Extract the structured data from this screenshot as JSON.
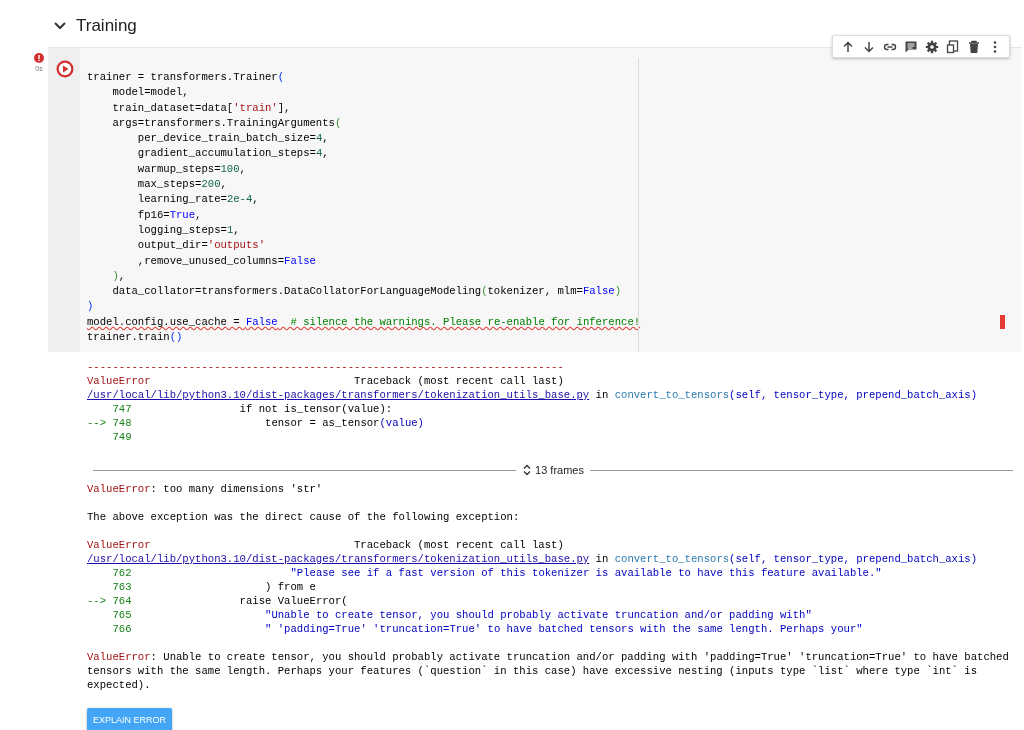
{
  "section": {
    "title": "Training",
    "expanded": true
  },
  "cell": {
    "has_error": true,
    "exec_time": "0s",
    "has_error_marker": true
  },
  "code_lines": [
    [
      {
        "text": "trainer = transformers.Trainer",
        "kind": "text"
      },
      {
        "text": "(",
        "kind": "bracket1"
      }
    ],
    [
      {
        "text": "    model=model,",
        "kind": "text"
      }
    ],
    [
      {
        "text": "    train_dataset=data[",
        "kind": "text"
      },
      {
        "text": "'train'",
        "kind": "str"
      },
      {
        "text": "],",
        "kind": "text"
      }
    ],
    [
      {
        "text": "    args=transformers.TrainingArguments",
        "kind": "text"
      },
      {
        "text": "(",
        "kind": "bracket2"
      }
    ],
    [
      {
        "text": "        per_device_train_batch_size=",
        "kind": "text"
      },
      {
        "text": "4",
        "kind": "num"
      },
      {
        "text": ",",
        "kind": "text"
      }
    ],
    [
      {
        "text": "        gradient_accumulation_steps=",
        "kind": "text"
      },
      {
        "text": "4",
        "kind": "num"
      },
      {
        "text": ",",
        "kind": "text"
      }
    ],
    [
      {
        "text": "        warmup_steps=",
        "kind": "text"
      },
      {
        "text": "100",
        "kind": "num"
      },
      {
        "text": ",",
        "kind": "text"
      }
    ],
    [
      {
        "text": "        max_steps=",
        "kind": "text"
      },
      {
        "text": "200",
        "kind": "num"
      },
      {
        "text": ",",
        "kind": "text"
      }
    ],
    [
      {
        "text": "        learning_rate=",
        "kind": "text"
      },
      {
        "text": "2e-4",
        "kind": "num"
      },
      {
        "text": ",",
        "kind": "text"
      }
    ],
    [
      {
        "text": "        fp16=",
        "kind": "text"
      },
      {
        "text": "True",
        "kind": "kw"
      },
      {
        "text": ",",
        "kind": "text"
      }
    ],
    [
      {
        "text": "        logging_steps=",
        "kind": "text"
      },
      {
        "text": "1",
        "kind": "num"
      },
      {
        "text": ",",
        "kind": "text"
      }
    ],
    [
      {
        "text": "        output_dir=",
        "kind": "text"
      },
      {
        "text": "'outputs'",
        "kind": "str"
      }
    ],
    [
      {
        "text": "        ,remove_unused_columns=",
        "kind": "text"
      },
      {
        "text": "False",
        "kind": "kw"
      }
    ],
    [
      {
        "text": "    )",
        "kind": "bracket2"
      },
      {
        "text": ",",
        "kind": "text"
      }
    ],
    [
      {
        "text": "    data_collator=transformers.DataCollatorForLanguageModeling",
        "kind": "text"
      },
      {
        "text": "(",
        "kind": "bracket2"
      },
      {
        "text": "tokenizer, mlm=",
        "kind": "text"
      },
      {
        "text": "False",
        "kind": "kw"
      },
      {
        "text": ")",
        "kind": "bracket2"
      }
    ],
    [
      {
        "text": ")",
        "kind": "bracket1"
      }
    ],
    [
      {
        "text": "model.config.use_cache = ",
        "kind": "text",
        "lint_error": true
      },
      {
        "text": "False",
        "kind": "kw",
        "lint_error": true
      },
      {
        "text": "  # silence the warnings. Please re-enable for inference!",
        "kind": "comment",
        "lint_error": true
      }
    ],
    [
      {
        "text": "trainer.train",
        "kind": "text"
      },
      {
        "text": "()",
        "kind": "bracket1"
      }
    ]
  ],
  "output": [
    {
      "kind": "line",
      "segments": [
        {
          "text": "---------------------------------------------------------------------------",
          "kind": "err"
        }
      ]
    },
    {
      "kind": "line",
      "segments": [
        {
          "text": "ValueError",
          "kind": "err"
        },
        {
          "text": "                                Traceback (most recent call last)",
          "kind": "text"
        }
      ]
    },
    {
      "kind": "line",
      "segments": [
        {
          "text": "/usr/local/lib/python3.10/dist-packages/transformers/tokenization_utils_base.py",
          "kind": "link"
        },
        {
          "text": " in ",
          "kind": "text"
        },
        {
          "text": "convert_to_tensors",
          "kind": "func"
        },
        {
          "text": "(self, tensor_type, prepend_batch_axis)",
          "kind": "str"
        }
      ]
    },
    {
      "kind": "line",
      "segments": [
        {
          "text": "    747",
          "kind": "lineno"
        },
        {
          "text": "                 if not is_tensor(value):",
          "kind": "text"
        }
      ]
    },
    {
      "kind": "line",
      "segments": [
        {
          "text": "--> 748",
          "kind": "lineno"
        },
        {
          "text": "                     tensor = as_tensor",
          "kind": "text"
        },
        {
          "text": "(value)",
          "kind": "str"
        }
      ]
    },
    {
      "kind": "line",
      "segments": [
        {
          "text": "    749",
          "kind": "lineno"
        }
      ]
    },
    {
      "kind": "blank"
    },
    {
      "kind": "divider",
      "label": "13 frames"
    },
    {
      "kind": "line",
      "segments": [
        {
          "text": "ValueError",
          "kind": "err"
        },
        {
          "text": ": too many dimensions 'str'",
          "kind": "text"
        }
      ]
    },
    {
      "kind": "blank"
    },
    {
      "kind": "line",
      "segments": [
        {
          "text": "The above exception was the direct cause of the following exception:",
          "kind": "text"
        }
      ]
    },
    {
      "kind": "blank"
    },
    {
      "kind": "line",
      "segments": [
        {
          "text": "ValueError",
          "kind": "err"
        },
        {
          "text": "                                Traceback (most recent call last)",
          "kind": "text"
        }
      ]
    },
    {
      "kind": "line",
      "segments": [
        {
          "text": "/usr/local/lib/python3.10/dist-packages/transformers/tokenization_utils_base.py",
          "kind": "link"
        },
        {
          "text": " in ",
          "kind": "text"
        },
        {
          "text": "convert_to_tensors",
          "kind": "func"
        },
        {
          "text": "(self, tensor_type, prepend_batch_axis)",
          "kind": "str"
        }
      ]
    },
    {
      "kind": "line",
      "segments": [
        {
          "text": "    762",
          "kind": "lineno"
        },
        {
          "text": "                         \"Please see if a fast version of this tokenizer is available to have this feature available.\"",
          "kind": "str"
        }
      ]
    },
    {
      "kind": "line",
      "segments": [
        {
          "text": "    763",
          "kind": "lineno"
        },
        {
          "text": "                     ) from e",
          "kind": "text"
        }
      ]
    },
    {
      "kind": "line",
      "segments": [
        {
          "text": "--> 764",
          "kind": "lineno"
        },
        {
          "text": "                 raise ValueError(",
          "kind": "text"
        }
      ]
    },
    {
      "kind": "line",
      "segments": [
        {
          "text": "    765",
          "kind": "lineno"
        },
        {
          "text": "                     \"Unable to create tensor, you should probably activate truncation and/or padding with\"",
          "kind": "str"
        }
      ]
    },
    {
      "kind": "line",
      "segments": [
        {
          "text": "    766",
          "kind": "lineno"
        },
        {
          "text": "                     \" 'padding=True' 'truncation=True' to have batched tensors with the same length. Perhaps your\"",
          "kind": "str"
        }
      ]
    },
    {
      "kind": "blank"
    },
    {
      "kind": "paragraph",
      "segments": [
        {
          "text": "ValueError",
          "kind": "err"
        },
        {
          "text": ": Unable to create tensor, you should probably activate truncation and/or padding with 'padding=True' 'truncation=True' to have batched tensors with the same length. Perhaps your features (`question` in this case) have excessive nesting (inputs type `list` where type `int` is expected).",
          "kind": "text"
        }
      ]
    },
    {
      "kind": "blank"
    },
    {
      "kind": "button",
      "label": "EXPLAIN ERROR"
    }
  ]
}
